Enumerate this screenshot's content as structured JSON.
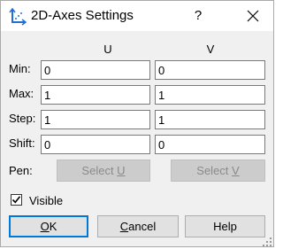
{
  "window": {
    "title": "2D-Axes Settings",
    "help_glyph": "?",
    "icon": "axes-icon"
  },
  "columns": {
    "u": "U",
    "v": "V"
  },
  "rows": {
    "min": {
      "label": "Min:",
      "u": "0",
      "v": "0"
    },
    "max": {
      "label": "Max:",
      "u": "1",
      "v": "1"
    },
    "step": {
      "label": "Step:",
      "u": "1",
      "v": "1"
    },
    "shift": {
      "label": "Shift:",
      "u": "0",
      "v": "0"
    }
  },
  "pen": {
    "label": "Pen:",
    "select_u": {
      "label": "Select ",
      "mnemonic": "U",
      "enabled": false
    },
    "select_v": {
      "label": "Select ",
      "mnemonic": "V",
      "enabled": false
    }
  },
  "visible": {
    "label": "Visible",
    "checked": true
  },
  "buttons": {
    "ok": {
      "mnemonic": "O",
      "rest": "K"
    },
    "cancel": {
      "mnemonic": "C",
      "rest": "ancel"
    },
    "help": "Help"
  },
  "colors": {
    "accent": "#0078d7",
    "dialog_bg": "#f0f0f0",
    "axis_icon": "#1e6fd9"
  }
}
